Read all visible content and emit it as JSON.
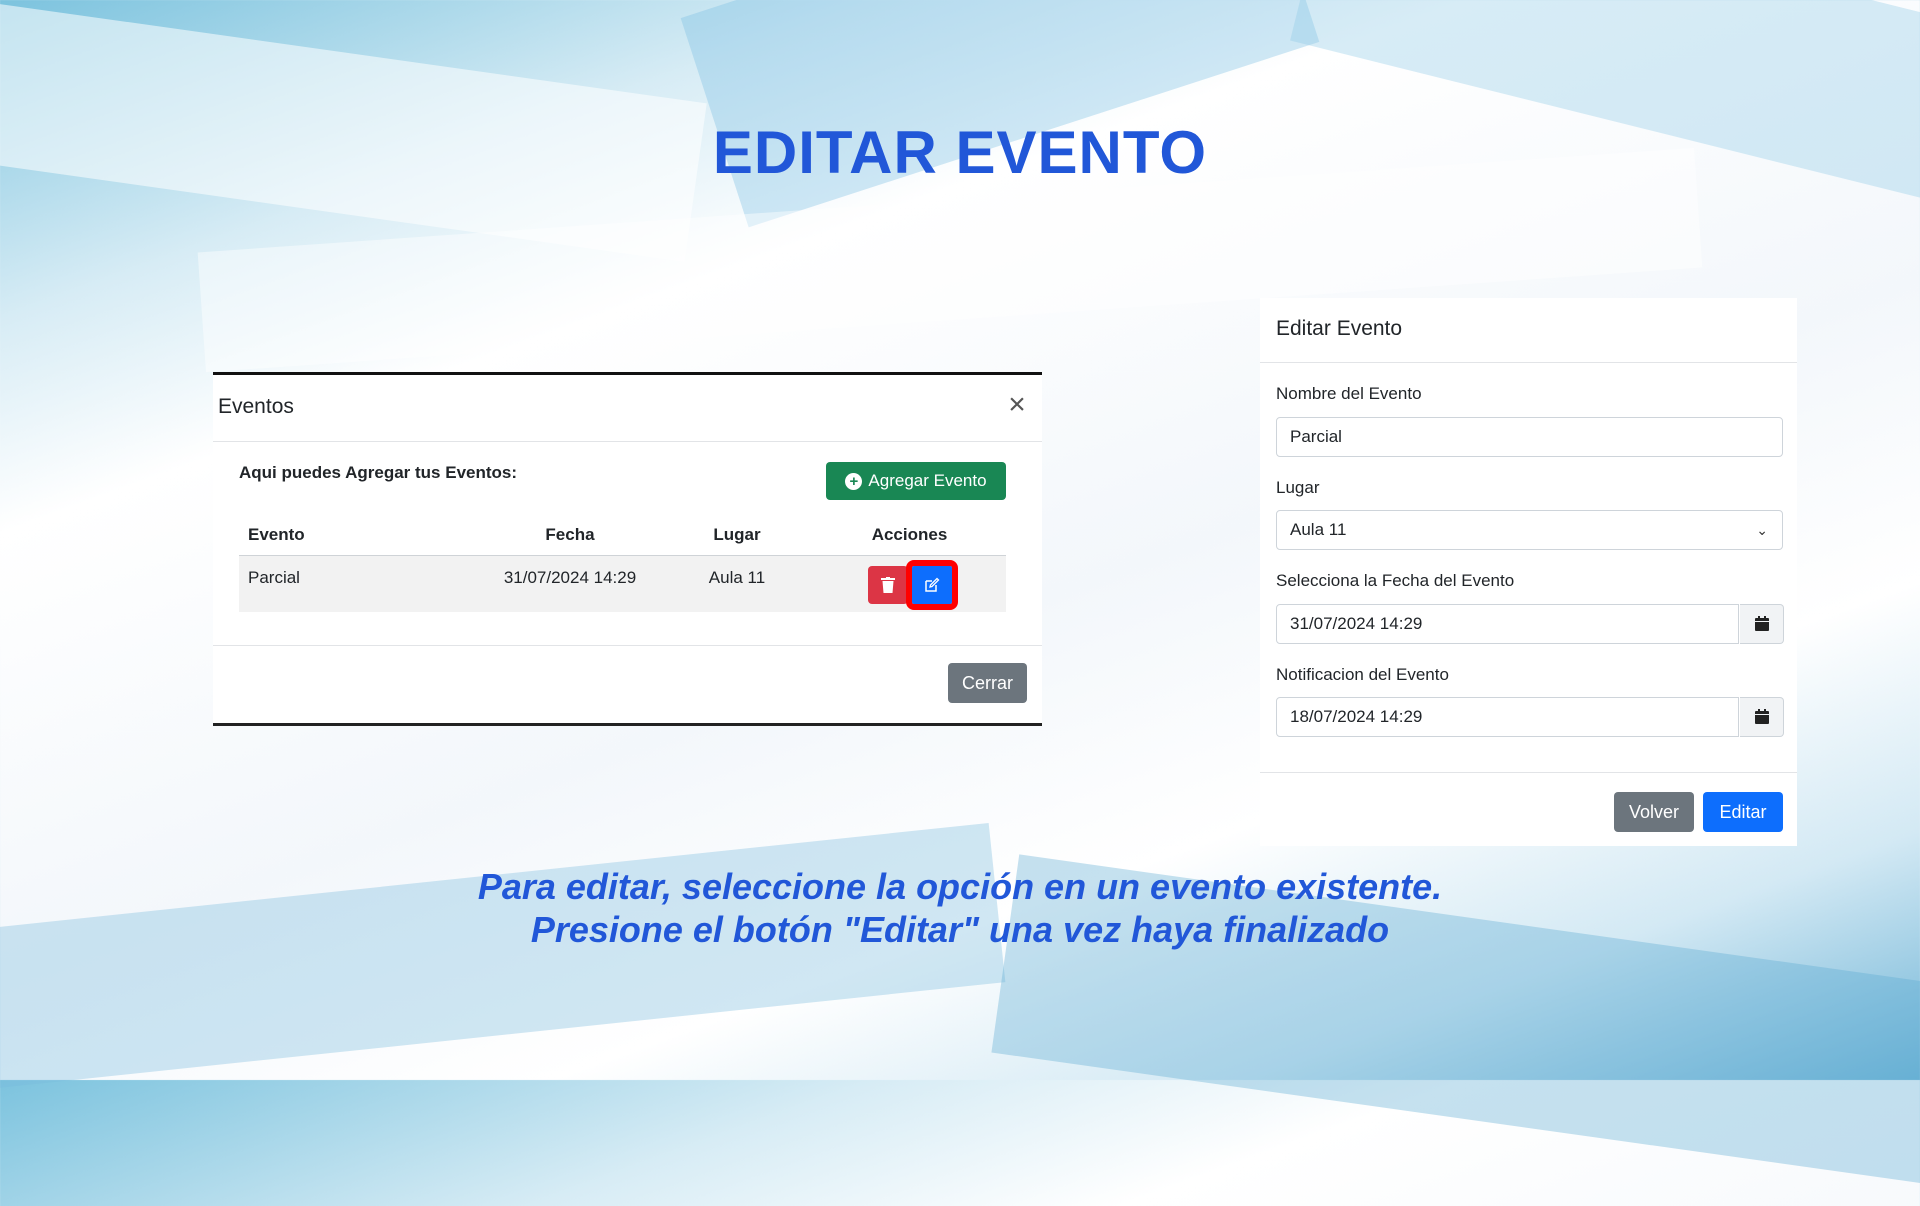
{
  "headline": "EDITAR EVENTO",
  "events_modal": {
    "title": "Eventos",
    "intro": "Aqui puedes Agregar tus Eventos:",
    "add_button_label": "Agregar Evento",
    "columns": [
      "Evento",
      "Fecha",
      "Lugar",
      "Acciones"
    ],
    "rows": [
      {
        "evento": "Parcial",
        "fecha": "31/07/2024 14:29",
        "lugar": "Aula 11"
      }
    ],
    "close_button_label": "Cerrar"
  },
  "edit_panel": {
    "title": "Editar Evento",
    "name_label": "Nombre del Evento",
    "name_value": "Parcial",
    "place_label": "Lugar",
    "place_value": "Aula 11",
    "date_label": "Selecciona la Fecha del Evento",
    "date_value": "31/07/2024 14:29",
    "notification_label": "Notificacion del Evento",
    "notification_value": "18/07/2024 14:29",
    "back_button_label": "Volver",
    "edit_button_label": "Editar"
  },
  "caption": {
    "line1": "Para editar, seleccione la opción en un evento existente.",
    "line2": "Presione el botón \"Editar\" una vez haya finalizado"
  },
  "colors": {
    "accent_text": "#2157d8",
    "success": "#198754",
    "danger": "#dc3545",
    "primary": "#0d6efd",
    "secondary": "#6c757d",
    "highlight": "#ff0000"
  },
  "icons": [
    "close-icon",
    "plus-circle-icon",
    "trash-icon",
    "edit-icon",
    "calendar-icon",
    "chevron-down-icon"
  ]
}
